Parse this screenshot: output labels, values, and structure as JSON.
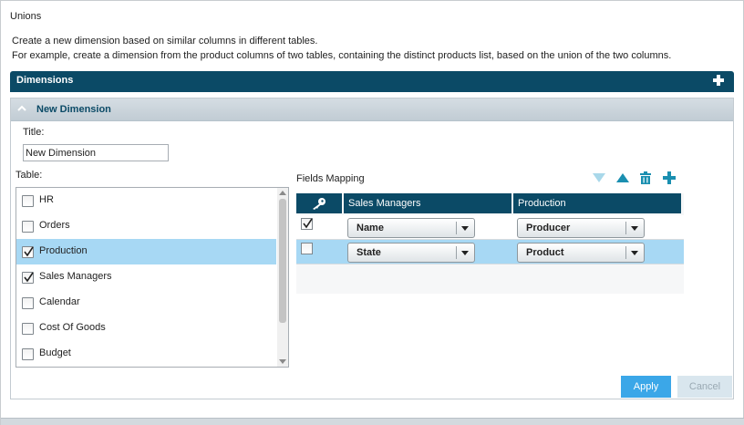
{
  "header": {
    "title": "Unions",
    "description_line1": "Create a new dimension based on similar columns in different tables.",
    "description_line2": "For example, create a dimension from the product columns of two tables, containing the distinct products list, based on the union of the two columns."
  },
  "dimensions_bar": {
    "label": "Dimensions",
    "add_icon": "plus-icon"
  },
  "new_dimension": {
    "header_label": "New Dimension",
    "collapse_icon": "chevron-up-icon",
    "title_label": "Title:",
    "title_value": "New Dimension",
    "table_label": "Table:",
    "tables": [
      {
        "name": "HR",
        "checked": false,
        "selected": false
      },
      {
        "name": "Orders",
        "checked": false,
        "selected": false
      },
      {
        "name": "Production",
        "checked": true,
        "selected": true
      },
      {
        "name": "Sales Managers",
        "checked": true,
        "selected": false
      },
      {
        "name": "Calendar",
        "checked": false,
        "selected": false
      },
      {
        "name": "Cost Of Goods",
        "checked": false,
        "selected": false
      },
      {
        "name": "Budget",
        "checked": false,
        "selected": false
      }
    ]
  },
  "fields_mapping": {
    "label": "Fields Mapping",
    "tools": [
      "move-down-icon",
      "move-up-icon",
      "trash-icon",
      "plus-icon"
    ],
    "columns": {
      "key_icon": "key-icon",
      "col1": "Sales Managers",
      "col2": "Production"
    },
    "rows": [
      {
        "checked": true,
        "selected": false,
        "col1": "Name",
        "col2": "Producer"
      },
      {
        "checked": false,
        "selected": true,
        "col1": "State",
        "col2": "Product"
      }
    ]
  },
  "buttons": {
    "apply": "Apply",
    "cancel": "Cancel"
  },
  "colors": {
    "header_dark": "#0b4a66",
    "selection": "#a7d8f4",
    "apply_button": "#3ba7e8",
    "tool_teal": "#1a8fb0"
  }
}
